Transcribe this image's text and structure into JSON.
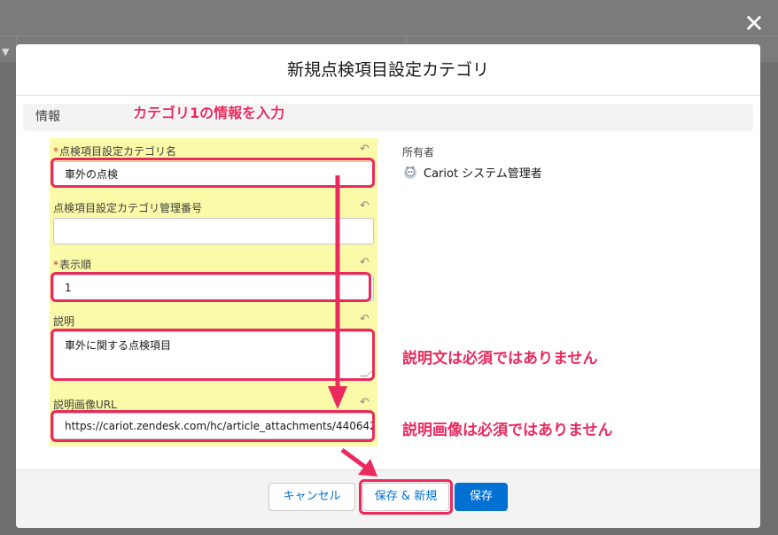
{
  "close_label": "✕",
  "modal": {
    "title": "新規点検項目設定カテゴリ"
  },
  "section": {
    "title": "情報"
  },
  "fields": {
    "category_name": {
      "label": "点検項目設定カテゴリ名",
      "value": "車外の点検",
      "required": "*"
    },
    "management_number": {
      "label": "点検項目設定カテゴリ管理番号",
      "value": ""
    },
    "display_order": {
      "label": "表示順",
      "value": "1",
      "required": "*"
    },
    "description": {
      "label": "説明",
      "value": "車外に関する点検項目"
    },
    "image_url": {
      "label": "説明画像URL",
      "value": "https://cariot.zendesk.com/hc/article_attachments/440642"
    }
  },
  "owner": {
    "label": "所有者",
    "name": "Cariot システム管理者"
  },
  "annotations": {
    "category_hint": "カテゴリ1の情報を入力",
    "description_hint": "説明文は必須ではありません",
    "image_hint": "説明画像は必須ではありません"
  },
  "footer": {
    "cancel_label": "キャンセル",
    "save_new_label": "保存 & 新規",
    "save_label": "保存"
  },
  "colors": {
    "annotation": "#ea2a5e",
    "brand": "#0070d2",
    "highlight_bg": "#fafaa8"
  },
  "icons": {
    "undo": "undo-icon",
    "close": "close-icon",
    "avatar": "user-avatar-icon"
  }
}
